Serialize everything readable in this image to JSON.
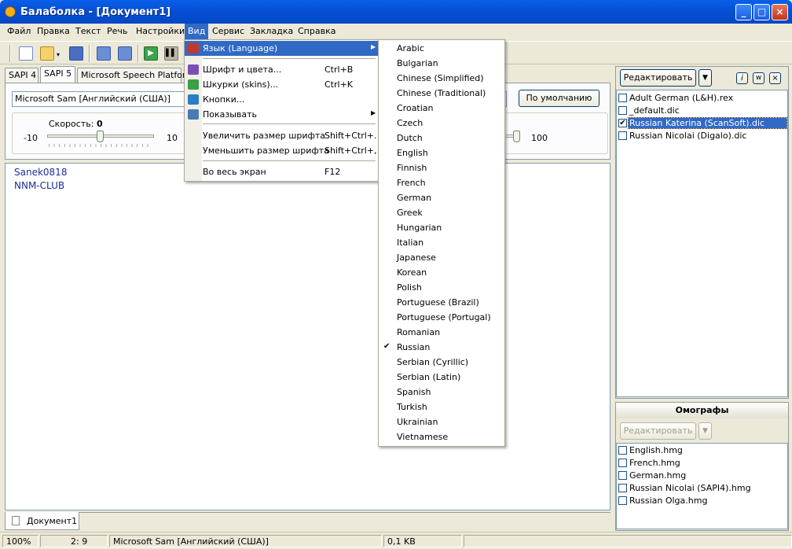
{
  "window": {
    "title": "Балаболка - [Документ1]",
    "controls": [
      "_",
      "□",
      "×"
    ]
  },
  "menubar": [
    "Файл",
    "Правка",
    "Текст",
    "Речь",
    "Настройки",
    "Вид",
    "Сервис",
    "Закладка",
    "Справка"
  ],
  "engine_tabs": [
    "SAPI 4",
    "SAPI 5",
    "Microsoft Speech Platform"
  ],
  "voice": {
    "selected": "Microsoft Sam [Английский (США)]",
    "default_button": "По умолчанию"
  },
  "rate": {
    "label": "Скорость:",
    "value": "0",
    "min": "-10",
    "max": "10",
    "level": 0.5
  },
  "volume": {
    "max": "100",
    "level": 1.0
  },
  "editor": {
    "lines": [
      "Sanek0818",
      "NNM-CLUB"
    ]
  },
  "view_menu": {
    "items": [
      {
        "label": "Язык (Language)",
        "shortcut": "",
        "submenu": true,
        "icon": "language-icon"
      },
      {
        "label": "Шрифт и цвета...",
        "shortcut": "Ctrl+B",
        "icon": "font-icon"
      },
      {
        "label": "Шкурки (skins)...",
        "shortcut": "Ctrl+K",
        "icon": "skins-icon"
      },
      {
        "label": "Кнопки...",
        "shortcut": "",
        "icon": "buttons-icon"
      },
      {
        "label": "Показывать",
        "shortcut": "",
        "submenu": true,
        "icon": "show-icon"
      },
      {
        "label": "Увеличить размер шрифта",
        "shortcut": "Shift+Ctrl+."
      },
      {
        "label": "Уменьшить размер шрифта",
        "shortcut": "Shift+Ctrl+,"
      },
      {
        "label": "Во весь экран",
        "shortcut": "F12"
      }
    ]
  },
  "language_menu": {
    "items": [
      "Arabic",
      "Bulgarian",
      "Chinese (Simplified)",
      "Chinese (Traditional)",
      "Croatian",
      "Czech",
      "Dutch",
      "English",
      "Finnish",
      "French",
      "German",
      "Greek",
      "Hungarian",
      "Italian",
      "Japanese",
      "Korean",
      "Polish",
      "Portuguese (Brazil)",
      "Portuguese (Portugal)",
      "Romanian",
      "Russian",
      "Serbian (Cyrillic)",
      "Serbian (Latin)",
      "Spanish",
      "Turkish",
      "Ukrainian",
      "Vietnamese"
    ],
    "checked": "Russian"
  },
  "dictionaries": {
    "edit_button": "Редактировать",
    "items": [
      {
        "name": "Adult German (L&H).rex",
        "checked": false
      },
      {
        "name": "_default.dic",
        "checked": false
      },
      {
        "name": "Russian Katerina (ScanSoft).dic",
        "checked": true
      },
      {
        "name": "Russian Nicolai (Digalo).dic",
        "checked": false
      }
    ]
  },
  "homographs": {
    "title": "Омографы",
    "edit_button": "Редактировать",
    "items": [
      {
        "name": "English.hmg",
        "checked": false
      },
      {
        "name": "French.hmg",
        "checked": false
      },
      {
        "name": "German.hmg",
        "checked": false
      },
      {
        "name": "Russian Nicolai (SAPI4).hmg",
        "checked": false
      },
      {
        "name": "Russian Olga.hmg",
        "checked": false
      }
    ]
  },
  "doc_tab": "Документ1",
  "status": {
    "zoom": "100%",
    "position": "2:   9",
    "voice": "Microsoft Sam [Английский (США)]",
    "size": "0,1 KB"
  },
  "colors": {
    "highlight": "#316ac5",
    "editor_text": "#1c2c9c"
  }
}
